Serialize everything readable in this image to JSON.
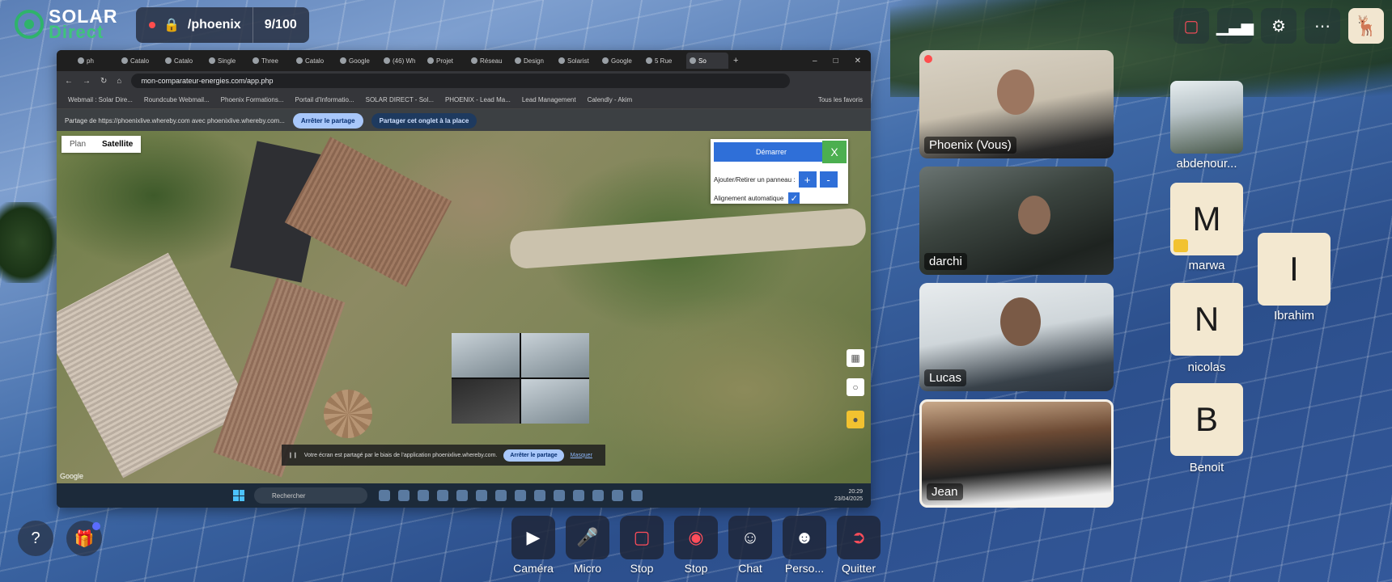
{
  "brand": {
    "line1": "SOLAR",
    "line2": "Direct"
  },
  "room": {
    "name": "/phoenix",
    "count": "9/100"
  },
  "top_right": {
    "icons": [
      "screen-share-off-icon",
      "signal-bars-icon",
      "gear-icon",
      "more-dots-icon"
    ],
    "avatar_icon": "deer-avatar"
  },
  "browser": {
    "tabs": [
      "ph",
      "Catalo",
      "Catalo",
      "Single",
      "Three",
      "Catalo",
      "Google",
      "(46) Wh",
      "Projet",
      "Réseau",
      "Design",
      "Solarist",
      "Google",
      "5 Rue",
      "So"
    ],
    "new_tab": "+",
    "url": "mon-comparateur-energies.com/app.php",
    "bookmarks": [
      "Webmail : Solar Dire...",
      "Roundcube Webmail...",
      "Phoenix Formations...",
      "Portail d'Informatio...",
      "SOLAR DIRECT - Sol...",
      "PHOENIX - Lead Ma...",
      "Lead Management",
      "Calendly - Akim",
      "Tous les favoris"
    ],
    "share_text": "Partage de https://phoenixlive.whereby.com avec phoenixlive.whereby.com...",
    "stop_share": "Arrêter le partage",
    "share_tab": "Partager cet onglet à la place"
  },
  "map": {
    "toggle_plan": "Plan",
    "toggle_satellite": "Satellite",
    "start_button": "Démarrer",
    "close_button": "X",
    "panel_label": "Ajouter/Retirer un panneau :",
    "plus": "+",
    "minus": "-",
    "align_label": "Alignement automatique",
    "align_checked": "✓",
    "google": "Google",
    "banner_text": "Votre écran est partagé par le biais de l'application phoenixlive.whereby.com.",
    "banner_stop": "Arrêter le partage",
    "banner_hide": "Masquer"
  },
  "taskbar": {
    "search": "Rechercher",
    "time": "20:29",
    "date": "23/04/2025"
  },
  "participants": [
    {
      "name": "Phoenix (Vous)"
    },
    {
      "name": "darchi"
    },
    {
      "name": "Lucas"
    },
    {
      "name": "Jean"
    }
  ],
  "side_participants": [
    {
      "name": "abdenour...",
      "initial": ""
    },
    {
      "name": "marwa",
      "initial": "M"
    },
    {
      "name": "Ibrahim",
      "initial": "I"
    },
    {
      "name": "nicolas",
      "initial": "N"
    },
    {
      "name": "Benoit",
      "initial": "B"
    }
  ],
  "bottom_left": {
    "help": "?",
    "gift_icon": "gift-icon"
  },
  "controls": [
    {
      "label": "Caméra",
      "icon": "camera-icon"
    },
    {
      "label": "Micro",
      "icon": "mic-icon"
    },
    {
      "label": "Stop",
      "icon": "screen-share-icon"
    },
    {
      "label": "Stop",
      "icon": "record-icon"
    },
    {
      "label": "Chat",
      "icon": "chat-icon"
    },
    {
      "label": "Perso...",
      "icon": "people-icon"
    },
    {
      "label": "Quitter",
      "icon": "leave-icon"
    }
  ],
  "colors": {
    "accent_green": "#2fb36b",
    "alert_red": "#ff4d5a",
    "chrome_blue": "#2f6fd8"
  }
}
